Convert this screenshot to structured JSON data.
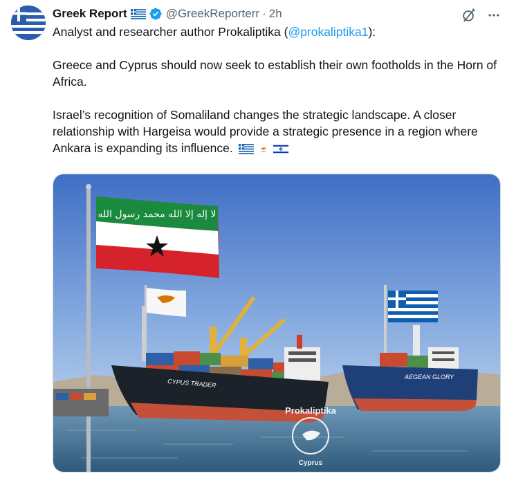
{
  "author": {
    "name": "Greek Report",
    "handle": "@GreekReporterr",
    "separator": "·",
    "time": "2h"
  },
  "tweet": {
    "line1_prefix": "Analyst and researcher author Prokaliptika (",
    "mention": "@prokaliptika1",
    "line1_suffix": "):",
    "paragraph2": "Greece and Cyprus should now seek to establish their own footholds in the Horn of Africa.",
    "paragraph3": "Israel’s recognition of Somaliland changes the strategic landscape. A closer relationship with Hargeisa would provide a strategic presence in a region where Ankara is expanding its influence."
  },
  "media": {
    "ship_left_name": "CYPUS TRADER",
    "ship_right_name": "AEGEAN GLORY",
    "flag_script": "لا إله إلا الله محمد رسول الله",
    "watermark_top": "Prokaliptika",
    "watermark_bottom": "Cyprus"
  },
  "icons": {
    "verified": "verified-badge-icon",
    "grok": "grok-icon",
    "more": "more-icon"
  },
  "colors": {
    "link": "#1d9bf0",
    "secondary_text": "#536471",
    "verified": "#1d9bf0"
  }
}
